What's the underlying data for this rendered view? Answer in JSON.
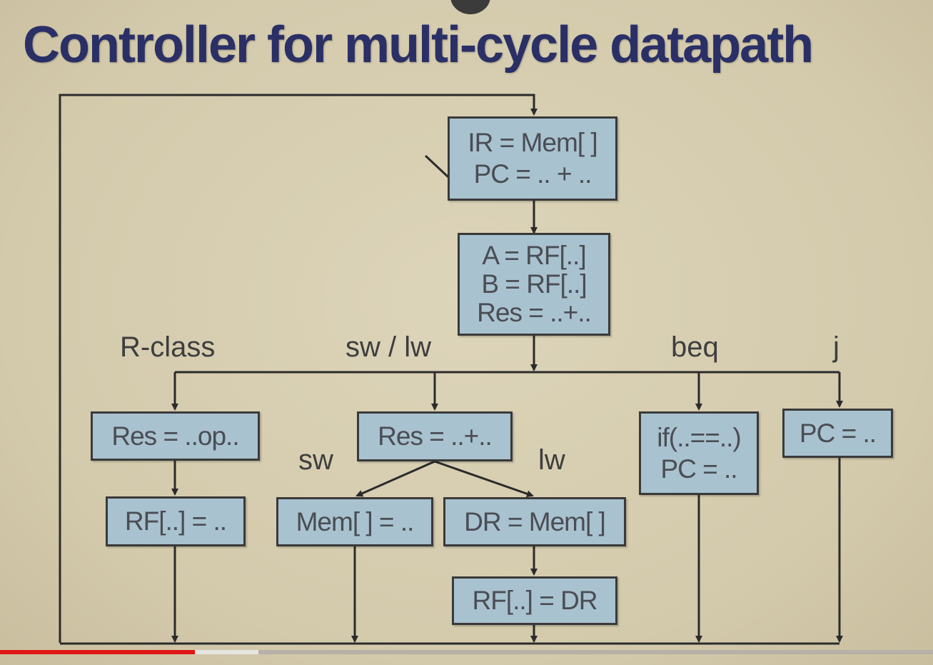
{
  "title": "Controller for multi-cycle datapath",
  "states": {
    "fetch": [
      "IR = Mem[ ]",
      "PC = .. + .."
    ],
    "decode": [
      "A = RF[..]",
      "B = RF[..]",
      "Res = ..+.."
    ],
    "r_exec": [
      "Res = ..op.."
    ],
    "r_write": [
      "RF[..] = .."
    ],
    "mem_addr": [
      "Res = ..+.."
    ],
    "sw_store": [
      "Mem[ ] = .."
    ],
    "lw_load": [
      "DR = Mem[ ]"
    ],
    "lw_write": [
      "RF[..] = DR"
    ],
    "beq": [
      "if(..==..)",
      "PC = .."
    ],
    "jump": [
      "PC = .."
    ]
  },
  "branch_labels": {
    "r_class": "R-class",
    "sw_lw": "sw / lw",
    "beq": "beq",
    "j": "j",
    "sw": "sw",
    "lw": "lw"
  },
  "colors": {
    "title": "#2a2f66",
    "box_fill": "#a9c2cf",
    "box_border": "#3a3a3a",
    "wire": "#2b2b2b",
    "background": "#d8cfb3",
    "progress": "#e21616"
  },
  "video_progress": 0.209
}
